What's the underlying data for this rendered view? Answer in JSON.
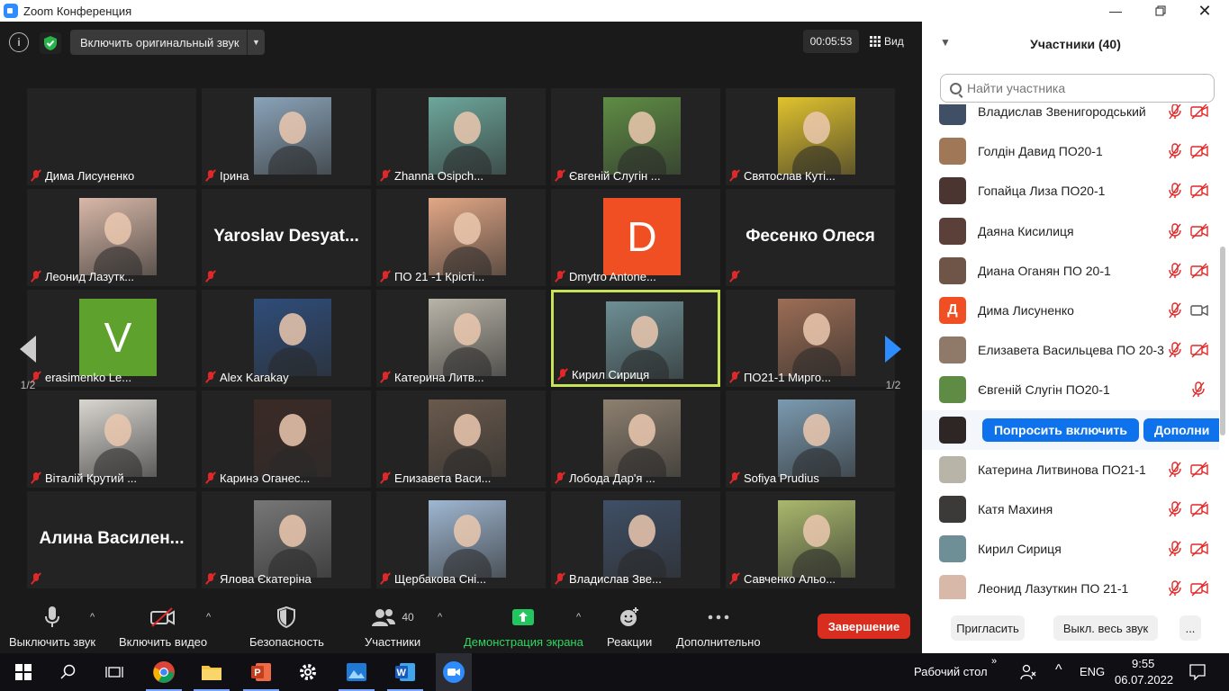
{
  "window": {
    "title": "Zoom Конференция"
  },
  "meeting_top": {
    "audio_button": "Включить оригинальный звук",
    "timer": "00:05:53",
    "view_label": "Вид"
  },
  "pager": {
    "left": "1/2",
    "right": "1/2"
  },
  "tiles": [
    {
      "name": "Дима Лисуненко",
      "type": "blank"
    },
    {
      "name": "Ірина",
      "type": "photo",
      "color": "#8aa3b8"
    },
    {
      "name": "Zhanna Osipch...",
      "type": "photo",
      "color": "#6da79c"
    },
    {
      "name": "Євгеній Слугін ...",
      "type": "photo",
      "color": "#5f8c44"
    },
    {
      "name": "Святослав Куті...",
      "type": "photo",
      "color": "#e0c22e"
    },
    {
      "name": "Леонид Лазутк...",
      "type": "photo",
      "color": "#d8b8a8"
    },
    {
      "name": "",
      "type": "bigname",
      "big": "Yaroslav  Desyat..."
    },
    {
      "name": "ПО 21 -1 Крісті...",
      "type": "photo",
      "color": "#e2a786"
    },
    {
      "name": "Dmytro Antone...",
      "type": "letter",
      "letter": "D",
      "color": "#f04e23"
    },
    {
      "name": "",
      "type": "bigname",
      "big": "Фесенко Олеся"
    },
    {
      "name": "erasimenko Le...",
      "type": "letter",
      "letter": "V",
      "color": "#5ea12d"
    },
    {
      "name": "Alex Karakay",
      "type": "photo",
      "color": "#2f4d7a"
    },
    {
      "name": "Катерина Литв...",
      "type": "photo",
      "color": "#b9b4a8"
    },
    {
      "name": "Кирил Сириця",
      "type": "photo",
      "color": "#6d8f95",
      "active": true
    },
    {
      "name": "ПО21-1 Мирго...",
      "type": "photo",
      "color": "#9c6d55"
    },
    {
      "name": "Віталій Крутий ...",
      "type": "photo",
      "color": "#d9d6d0"
    },
    {
      "name": "Каринэ Оганес...",
      "type": "photo",
      "color": "#3b2a26"
    },
    {
      "name": "Елизавета Васи...",
      "type": "photo",
      "color": "#6a5a4d"
    },
    {
      "name": "Лобода Дар'я ...",
      "type": "photo",
      "color": "#8d8070"
    },
    {
      "name": "Sofiya Prudius",
      "type": "photo",
      "color": "#7b9ab0"
    },
    {
      "name": "",
      "type": "bigname",
      "big": "Алина  Василен..."
    },
    {
      "name": "Ялова Єкатеріна",
      "type": "photo",
      "color": "#777777"
    },
    {
      "name": "Щербакова Сні...",
      "type": "photo",
      "color": "#9fb7d1"
    },
    {
      "name": "Владислав Зве...",
      "type": "photo",
      "color": "#3f4f66"
    },
    {
      "name": "Савченко Альо...",
      "type": "photo",
      "color": "#a9b86d"
    }
  ],
  "toolbar": {
    "mute": "Выключить звук",
    "video": "Включить видео",
    "security": "Безопасность",
    "participants": "Участники",
    "participants_count": "40",
    "share": "Демонстрация экрана",
    "reactions": "Реакции",
    "more": "Дополнительно",
    "end": "Завершение"
  },
  "panel": {
    "title": "Участники (40)",
    "search_placeholder": "Найти участника",
    "participants": [
      {
        "name": "Владислав Звенигородський",
        "avatar": "#3f4f66",
        "letter": "",
        "cam": "off"
      },
      {
        "name": "Голдін Давид ПО20-1",
        "avatar": "#a07858",
        "letter": "",
        "cam": "off"
      },
      {
        "name": "Гопайца Лиза ПО20-1",
        "avatar": "#4a3530",
        "letter": "",
        "cam": "off"
      },
      {
        "name": "Даяна Кисилиця",
        "avatar": "#5a4038",
        "letter": "",
        "cam": "off"
      },
      {
        "name": "Диана Оганян ПО 20-1",
        "avatar": "#6e5548",
        "letter": "",
        "cam": "off"
      },
      {
        "name": "Дима Лисуненко",
        "avatar": "#f04e23",
        "letter": "Д",
        "cam": "on"
      },
      {
        "name": "Елизавета Васильцева ПО 20-3",
        "avatar": "#8f7a6a",
        "letter": "",
        "cam": "off"
      },
      {
        "name": "Євгеній Слугін ПО20-1",
        "avatar": "#5f8c44",
        "letter": "",
        "cam": "none"
      },
      {
        "name": "",
        "avatar": "#2e2624",
        "letter": "",
        "cam": "hover"
      },
      {
        "name": "Катерина Литвинова ПО21-1",
        "avatar": "#b9b4a8",
        "letter": "",
        "cam": "off"
      },
      {
        "name": "Катя Махиня",
        "avatar": "#3c3a38",
        "letter": "",
        "cam": "off"
      },
      {
        "name": "Кирил Сириця",
        "avatar": "#6d8f95",
        "letter": "",
        "cam": "off"
      },
      {
        "name": "Леонид Лазуткин ПО 21-1",
        "avatar": "#d8b8a8",
        "letter": "",
        "cam": "off"
      }
    ],
    "hover_ask": "Попросить включить",
    "hover_more": "Дополни",
    "invite": "Пригласить",
    "mute_all": "Выкл. весь звук",
    "more": "..."
  },
  "taskbar": {
    "desktop": "Рабочий стол",
    "lang": "ENG",
    "time": "9:55",
    "date": "06.07.2022"
  }
}
